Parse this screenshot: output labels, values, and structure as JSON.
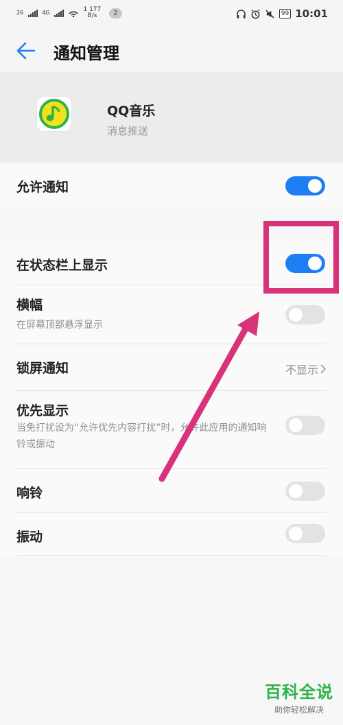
{
  "status_bar": {
    "sim1_label": "26",
    "sim2_label": "4G",
    "speed_value": "1 177",
    "speed_unit": "B/s",
    "notification_count": "2",
    "battery": "99",
    "time": "10:01"
  },
  "app_bar": {
    "title": "通知管理"
  },
  "app_info": {
    "name": "QQ音乐",
    "subtitle": "消息推送"
  },
  "settings": {
    "allow_notifications": {
      "label": "允许通知",
      "enabled": true
    },
    "status_bar_display": {
      "label": "在状态栏上显示",
      "enabled": true
    },
    "banner": {
      "label": "横幅",
      "description": "在屏幕顶部悬浮显示",
      "enabled": false
    },
    "lock_screen": {
      "label": "锁屏通知",
      "value": "不显示"
    },
    "priority": {
      "label": "优先显示",
      "description": "当免打扰设为“允许优先内容打扰”时，允许此应用的通知响铃或振动",
      "enabled": false
    },
    "ringtone": {
      "label": "响铃",
      "enabled": false
    },
    "vibration": {
      "label": "振动",
      "enabled": false
    }
  },
  "watermark": {
    "title": "百科全说",
    "subtitle": "助你轻松解决"
  },
  "colors": {
    "accent": "#1e7ef3",
    "highlight": "#d7327a",
    "watermark_green": "#2db34a"
  }
}
